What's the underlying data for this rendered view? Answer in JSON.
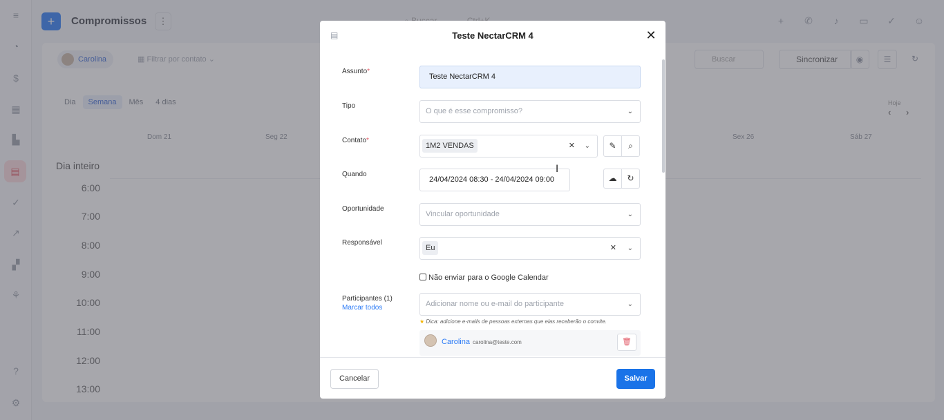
{
  "app": {
    "title": "Compromissos",
    "add_icon": "plus-icon",
    "more_icon": "⋮",
    "search_placeholder": "Buscar",
    "search_shortcut": "Ctrl+K"
  },
  "toolbar": {
    "user_chip": "Carolina",
    "filter_contact": "Filtrar por contato",
    "search_placeholder": "Buscar",
    "sync_label": "Sincronizar"
  },
  "calendar": {
    "views": [
      "Dia",
      "Semana",
      "Mês",
      "4 dias"
    ],
    "selected_view": "Semana",
    "today_label": "Hoje",
    "days": [
      "Dom 21",
      "Seg 22",
      "Sex 26",
      "Sáb 27"
    ],
    "allday_label": "Dia inteiro",
    "hours": [
      "6:00",
      "7:00",
      "8:00",
      "9:00",
      "10:00",
      "11:00",
      "12:00",
      "13:00"
    ]
  },
  "modal": {
    "title": "Teste NectarCRM 4",
    "close_icon": "close-icon",
    "fields": {
      "assunto": {
        "label": "Assunto",
        "value": "Teste NectarCRM 4"
      },
      "tipo": {
        "label": "Tipo",
        "placeholder": "O que é esse compromisso?"
      },
      "contato": {
        "label": "Contato",
        "value": "1M2 VENDAS"
      },
      "quando": {
        "label": "Quando",
        "value": "24/04/2024 08:30 - 24/04/2024 09:00"
      },
      "oportunidade": {
        "label": "Oportunidade",
        "placeholder": "Vincular oportunidade"
      },
      "responsavel": {
        "label": "Responsável",
        "value": "Eu"
      },
      "google_checkbox": "Não enviar para o Google Calendar",
      "participantes": {
        "label": "Participantes (1)",
        "mark_all": "Marcar todos",
        "placeholder": "Adicionar nome ou e-mail do participante",
        "tip": "Dica: adicione e-mails de pessoas externas que elas receberão o convite."
      }
    },
    "participants": [
      {
        "name": "Carolina",
        "email": "carolina@teste.com"
      }
    ],
    "cancel_label": "Cancelar",
    "save_label": "Salvar"
  },
  "colors": {
    "primary": "#1a73e8",
    "required": "#e25a67",
    "active_sidebar": "#fbd9dc"
  }
}
